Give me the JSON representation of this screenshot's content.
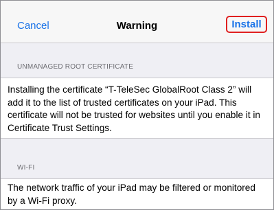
{
  "navbar": {
    "cancel_label": "Cancel",
    "title": "Warning",
    "install_label": "Install"
  },
  "sections": [
    {
      "header": "UNMANAGED ROOT CERTIFICATE",
      "text": "Installing the certificate “T-TeleSec GlobalRoot Class 2” will add it to the list of trusted certificates on your iPad. This certificate will not be trusted for websites until you enable it in Certificate Trust Settings."
    },
    {
      "header": "WI-FI",
      "text": "The network traffic of your iPad may be filtered or monitored by a Wi-Fi proxy."
    }
  ],
  "colors": {
    "accent": "#1a73e8",
    "highlight_border": "#e02020",
    "background": "#efeff4"
  }
}
